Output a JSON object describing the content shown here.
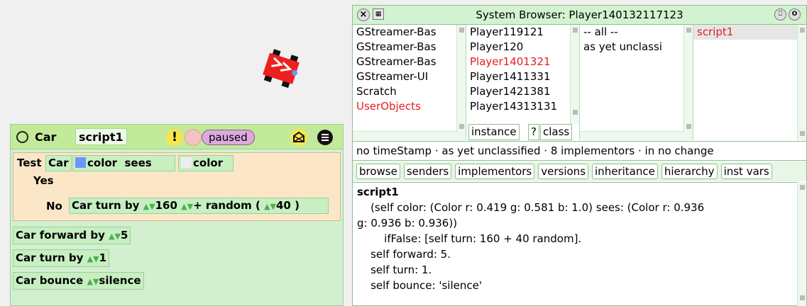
{
  "editor": {
    "title": "Car",
    "script_name": "script1",
    "status": "paused",
    "test_label": "Test",
    "yes_label": "Yes",
    "no_label": "No",
    "test": {
      "object": "Car",
      "color_word": "color",
      "sees_word": "sees",
      "color_word2": "color"
    },
    "no_branch": {
      "object": "Car",
      "command": "turn by",
      "value": "160",
      "plus": "+",
      "random": "random",
      "lparen": "(",
      "random_value": "40",
      "rparen": ")"
    },
    "commands": [
      {
        "object": "Car",
        "command": "forward by",
        "value": "5"
      },
      {
        "object": "Car",
        "command": "turn by",
        "value": "1"
      },
      {
        "object": "Car",
        "command": "bounce",
        "value": "silence"
      }
    ]
  },
  "browser": {
    "title": "System Browser: Player140132117123",
    "categories": [
      {
        "label": "GStreamer-Bas"
      },
      {
        "label": "GStreamer-Bas"
      },
      {
        "label": "GStreamer-Bas"
      },
      {
        "label": "GStreamer-UI"
      },
      {
        "label": "Scratch"
      },
      {
        "label": "UserObjects",
        "selected": true
      }
    ],
    "classes": [
      {
        "label": "Player119121"
      },
      {
        "label": "Player120"
      },
      {
        "label": "Player1401321",
        "selected": true
      },
      {
        "label": "Player1411331"
      },
      {
        "label": "Player1421381"
      },
      {
        "label": "Player14313131"
      }
    ],
    "protocols": [
      {
        "label": "-- all --"
      },
      {
        "label": "as yet unclassi"
      }
    ],
    "methods": [
      {
        "label": "script1",
        "selected": true
      }
    ],
    "instance_label": "instance",
    "help_label": "?",
    "class_label": "class",
    "info": "no timeStamp · as yet unclassified · 8 implementors · in no change",
    "tools": [
      "browse",
      "senders",
      "implementors",
      "versions",
      "inheritance",
      "hierarchy",
      "inst vars"
    ],
    "code_lines": [
      "script1",
      "    (self color: (Color r: 0.419 g: 0.581 b: 1.0) sees: (Color r: 0.936",
      "g: 0.936 b: 0.936))",
      "        ifFalse: [self turn: 160 + 40 random].",
      "    self forward: 5.",
      "    self turn: 1.",
      "    self bounce: 'silence'"
    ]
  },
  "colors": {
    "accent_red": "#e32020",
    "script_bg": "#d2f0d0",
    "test_bg": "#fbe7c8",
    "header_bg": "#c2ea9a"
  }
}
